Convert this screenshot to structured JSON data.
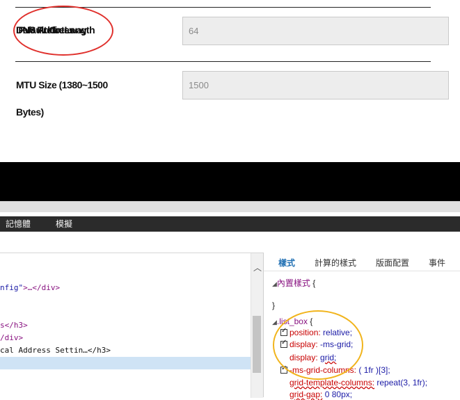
{
  "form": {
    "overlap_label_a": "IPv6 Prefix Length",
    "overlap_label_b": "Default Gateway",
    "overlap_label_c": "DNS Address",
    "prefix_value": "64",
    "mtu_label_line1": "MTU Size (1380~1500",
    "mtu_label_line2": "Bytes)",
    "mtu_value": "1500"
  },
  "devtools": {
    "tools_tabs": [
      "記憶體",
      "模擬"
    ],
    "dom_lines": [
      {
        "pre": "nfig\"",
        "tag": ">…</div>"
      },
      {
        "pre": "",
        "tag": "s</h3>"
      },
      {
        "pre": "",
        "tag": "/div>"
      },
      {
        "pre": "",
        "tag": "cal Address Settin…</h3>"
      }
    ],
    "styles_tabs": [
      "樣式",
      "計算的樣式",
      "版面配置",
      "事件"
    ],
    "inline_style": "內置樣式",
    "open_brace": "{",
    "close_brace": "}",
    "selector": ".list_box",
    "props": [
      {
        "name": "position:",
        "value": "relative;"
      },
      {
        "name": "display:",
        "value": "-ms-grid;"
      },
      {
        "name": "display:",
        "value": "grid;"
      },
      {
        "name": "-ms-grid-columns:",
        "value": "( 1fr )[3];"
      },
      {
        "name": "grid-template-columns:",
        "value": "repeat(3, 1fr);"
      },
      {
        "name": "grid-gap:",
        "value": "0 80px;"
      }
    ]
  },
  "colors": {
    "annotation_red": "#e0302c",
    "annotation_yellow": "#f1b41c",
    "active_tab": "#1f6fb3"
  }
}
